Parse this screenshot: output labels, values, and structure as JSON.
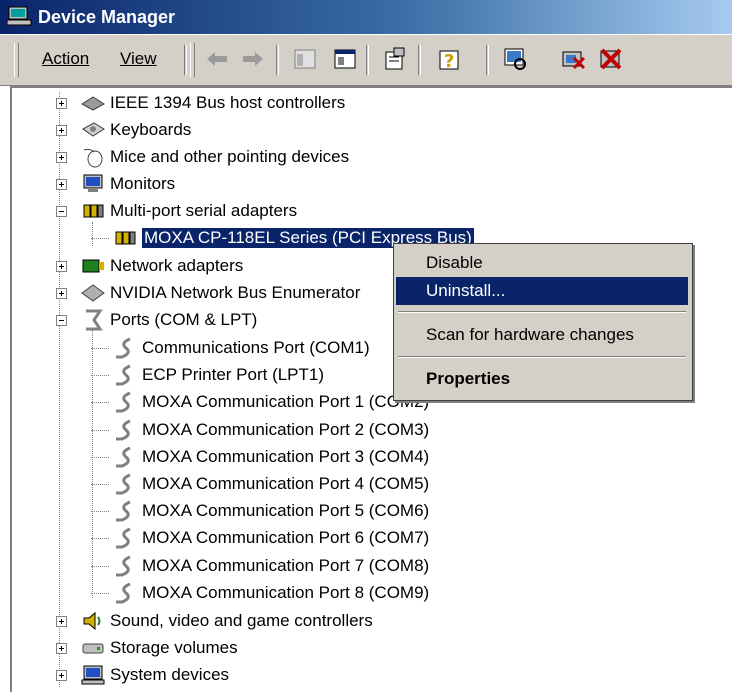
{
  "window": {
    "title": "Device Manager"
  },
  "menu": {
    "action": "Action",
    "view": "View"
  },
  "toolbar": {
    "buttons": [
      "back-icon",
      "forward-icon",
      "show-hide-tree-icon",
      "console-icon",
      "properties-icon",
      "help-icon",
      "scan-hardware-icon",
      "uninstall-icon",
      "disable-icon"
    ]
  },
  "tree": {
    "items": [
      {
        "label": "IEEE 1394 Bus host controllers"
      },
      {
        "label": "Keyboards"
      },
      {
        "label": "Mice and other pointing devices"
      },
      {
        "label": "Monitors"
      },
      {
        "label": "Multi-port serial adapters"
      },
      {
        "label": "MOXA CP-118EL Series (PCI Express Bus)"
      },
      {
        "label": "Network adapters"
      },
      {
        "label": "NVIDIA Network Bus Enumerator"
      },
      {
        "label": "Ports (COM & LPT)"
      },
      {
        "label": "Communications Port (COM1)"
      },
      {
        "label": "ECP Printer Port (LPT1)"
      },
      {
        "label": "MOXA Communication Port 1 (COM2)"
      },
      {
        "label": "MOXA Communication Port 2 (COM3)"
      },
      {
        "label": "MOXA Communication Port 3 (COM4)"
      },
      {
        "label": "MOXA Communication Port 4 (COM5)"
      },
      {
        "label": "MOXA Communication Port 5 (COM6)"
      },
      {
        "label": "MOXA Communication Port 6 (COM7)"
      },
      {
        "label": "MOXA Communication Port 7 (COM8)"
      },
      {
        "label": "MOXA Communication Port 8 (COM9)"
      },
      {
        "label": "Sound, video and game controllers"
      },
      {
        "label": "Storage volumes"
      },
      {
        "label": "System devices"
      }
    ]
  },
  "context_menu": {
    "disable": "Disable",
    "uninstall": "Uninstall...",
    "scan": "Scan for hardware changes",
    "properties": "Properties"
  },
  "colors": {
    "selection": "#0a246a",
    "face": "#d4d0c8"
  }
}
